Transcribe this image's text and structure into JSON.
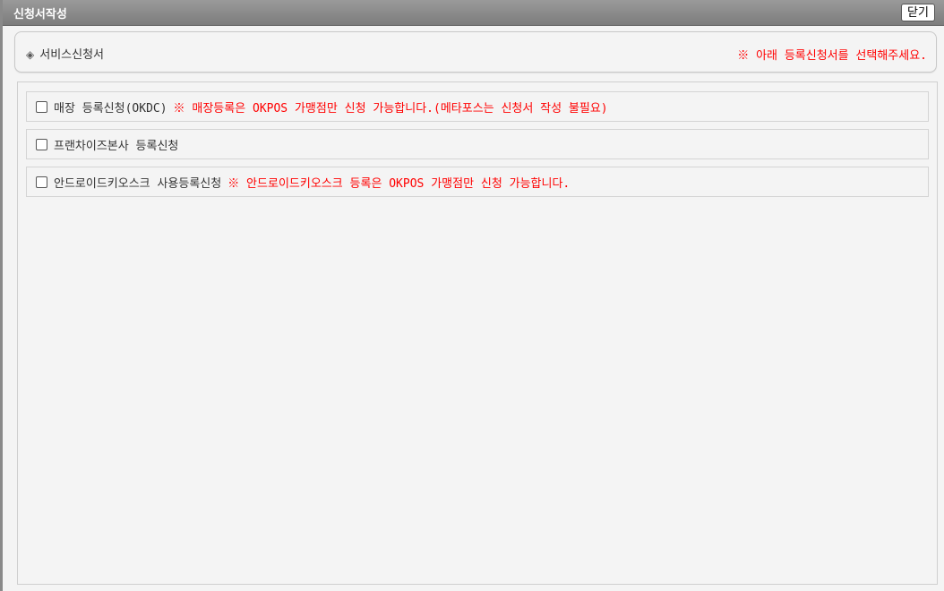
{
  "window": {
    "title": "신청서작성",
    "close_label": "닫기"
  },
  "header": {
    "icon": "diamond-icon",
    "icon_glyph": "◈",
    "section_title": "서비스신청서",
    "instruction": "※ 아래 등록신청서를 선택해주세요."
  },
  "options": [
    {
      "label": "매장 등록신청(OKDC)",
      "note": "※ 매장등록은 OKPOS 가맹점만 신청 가능합니다.(메타포스는 신청서 작성 불필요)",
      "checked": false
    },
    {
      "label": "프랜차이즈본사 등록신청",
      "note": "",
      "checked": false
    },
    {
      "label": "안드로이드키오스크 사용등록신청",
      "note": "※ 안드로이드키오스크 등록은 OKPOS 가맹점만 신청 가능합니다.",
      "checked": false
    }
  ],
  "colors": {
    "titlebar": "#808080",
    "accent_red": "#ff0000",
    "background": "#f4f4f4"
  }
}
